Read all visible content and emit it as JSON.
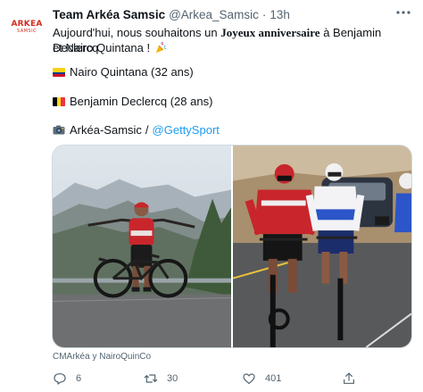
{
  "tweet": {
    "author": {
      "name": "Team Arkéa Samsic",
      "handle": "@Arkea_Samsic",
      "separator": "·",
      "time": "13h",
      "avatar_text": "ARKEA",
      "avatar_subtext": "SAMSIC",
      "brand_color": "#d62b1e"
    },
    "text": {
      "line1_pre": "Aujourd'hui, nous souhaitons un ",
      "line1_bold": "Joyeux anniversaire",
      "line1_post": " à Benjamin Declercq",
      "line2": "et Nairo Quintana ! ",
      "line2_emoji": "party-popper-emoji"
    },
    "mentions": [
      {
        "flag": "colombia-flag",
        "text": "Nairo Quintana (32 ans)"
      },
      {
        "flag": "belgium-flag",
        "text": "Benjamin Declercq (28 ans)"
      }
    ],
    "photo_credit_line": {
      "icon": "camera-icon",
      "team": "Arkéa-Samsic",
      "separator": "/",
      "link": "@GettySport"
    },
    "media_credit": "CMArkéa y NairoQuinCo",
    "actions": {
      "reply_count": "6",
      "retweet_count": "30",
      "like_count": "401"
    },
    "colors": {
      "link": "#1d9bf0",
      "secondary_text": "#536471",
      "jersey_red": "#c8262c"
    }
  }
}
